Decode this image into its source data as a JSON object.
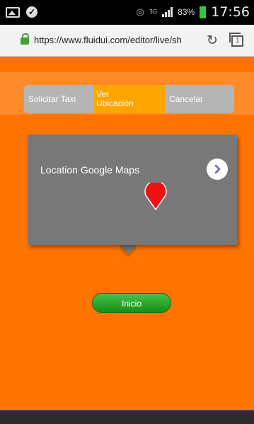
{
  "status_bar": {
    "network": "3G",
    "battery_percent": "83%",
    "time": "17:56"
  },
  "browser": {
    "url": "https://www.fluidui.com/editor/live/sh",
    "tab_count": "1"
  },
  "segmented_control": {
    "items": [
      {
        "label": "Solicitar Taxi",
        "selected": false
      },
      {
        "label": "Ver Ubicación",
        "selected": true
      },
      {
        "label": "Cancelar",
        "selected": false
      }
    ]
  },
  "map_card": {
    "title": "Location Google Maps"
  },
  "actions": {
    "start_label": "Inicio"
  },
  "colors": {
    "background": "#ff7400",
    "segment_selected": "#ffa500",
    "segment_default": "#b5b5b5",
    "card": "#787878",
    "pin": "#ee1111",
    "start_button": "#2aa52c"
  }
}
